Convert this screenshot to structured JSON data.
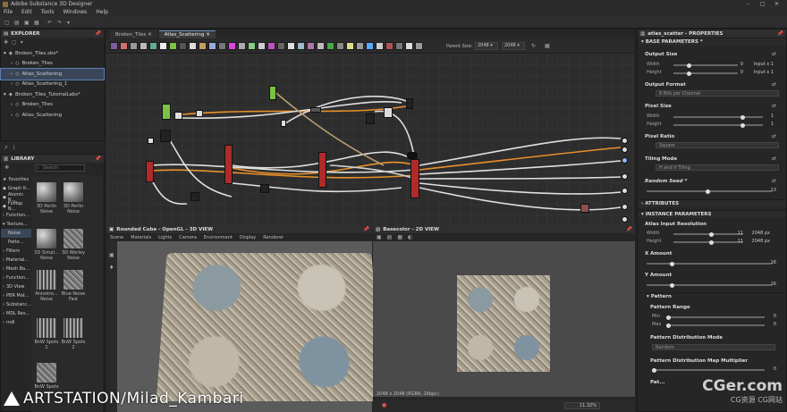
{
  "app": {
    "title": "Adobe Substance 3D Designer"
  },
  "menu": [
    "File",
    "Edit",
    "Tools",
    "Windows",
    "Help"
  ],
  "explorer": {
    "title": "EXPLORER",
    "items": [
      {
        "label": "Broken_Tiles.sbs*",
        "level": 0
      },
      {
        "label": "Broken_Tiles",
        "level": 1
      },
      {
        "label": "Atlas_Scattering",
        "level": 1,
        "selected": true
      },
      {
        "label": "Atlas_Scattering_1",
        "level": 1
      },
      {
        "label": "Broken_Tiles_TutorialLabs*",
        "level": 0
      },
      {
        "label": "Broken_Tiles",
        "level": 1
      },
      {
        "label": "Atlas_Scattering",
        "level": 1
      }
    ]
  },
  "library": {
    "title": "LIBRARY",
    "search_placeholder": "Search",
    "categories": [
      "Favorites",
      "Graph It...",
      "Atomic N...",
      "FxMap N...",
      "Function...",
      "Texture...",
      "Noise",
      "Patte...",
      "Filters",
      "Material...",
      "Mesh Ba...",
      "Function...",
      "3D View",
      "PBR Mat...",
      "Substanc...",
      "MDL Res...",
      "mdl"
    ],
    "thumbs": [
      "3D Perlin Noise",
      "3D Perlin Noise",
      "3D Simpl... Noise",
      "3D Worley Noise",
      "Anisotro... Noise",
      "Blue Noise Fast",
      "BnW Spots 1",
      "BnW Spots 2",
      "BnW Spots"
    ]
  },
  "graph": {
    "tabs": [
      "Broken_Tiles",
      "Atlas_Scattering"
    ],
    "parent_size_label": "Parent Size:",
    "parent_size": "2048",
    "size2": "2048"
  },
  "view3d": {
    "title": "Rounded Cube - OpenGL - 3D VIEW",
    "menu": [
      "Scene",
      "Materials",
      "Lights",
      "Camera",
      "Environment",
      "Display",
      "Renderer"
    ]
  },
  "view2d": {
    "title": "Basecolor - 2D VIEW",
    "status": "2048 x 2048 (RGBA, 16bpc)",
    "zoom": "11.32%"
  },
  "properties": {
    "title": "atlas_scatter - PROPERTIES",
    "sections": {
      "base": "BASE PARAMETERS *",
      "attributes": "ATTRIBUTES",
      "instance": "INSTANCE PARAMETERS",
      "pattern": "Pattern"
    },
    "output_size": {
      "label": "Output Size",
      "width_label": "Width",
      "height_label": "Height",
      "width_val": "0",
      "height_val": "0",
      "width_mode": "Input x 1",
      "height_mode": "Input x 1"
    },
    "output_format": {
      "label": "Output Format",
      "value": "8 Bits per Channel"
    },
    "pixel_size": {
      "label": "Pixel Size",
      "width_label": "Width",
      "height_label": "Height",
      "w": "1",
      "h": "1"
    },
    "pixel_ratio": {
      "label": "Pixel Ratio",
      "value": "Square"
    },
    "tiling_mode": {
      "label": "Tiling Mode",
      "value": "H and V Tiling"
    },
    "random_seed": {
      "label": "Random Seed *",
      "value": "13"
    },
    "atlas_res": {
      "label": "Atlas Input Resolution",
      "width_label": "Width",
      "height_label": "Height",
      "w": "11",
      "h": "11",
      "w_px": "2048 px",
      "h_px": "2048 px"
    },
    "x_amount": {
      "label": "X Amount",
      "value": "16"
    },
    "y_amount": {
      "label": "Y Amount",
      "value": "16"
    },
    "pattern_range": {
      "label": "Pattern Range",
      "min_label": "Min",
      "max_label": "Max",
      "min": "0",
      "max": "0"
    },
    "pattern_mode": {
      "label": "Pattern Distribution Mode",
      "value": "Random"
    },
    "pattern_mult": {
      "label": "Pattern Distribution Map Multiplier",
      "value": "0"
    },
    "pat_extra": "Pat..."
  },
  "watermark": {
    "left": "ARTSTATION/Milad_Kambari",
    "right": "CGer.com",
    "right_sub": "CG资源 CG网站"
  },
  "colors": {
    "accent": "#5a7fb0",
    "wire_orange": "#e8902a",
    "node_red": "#b02a2a",
    "node_green": "#7bc244"
  }
}
